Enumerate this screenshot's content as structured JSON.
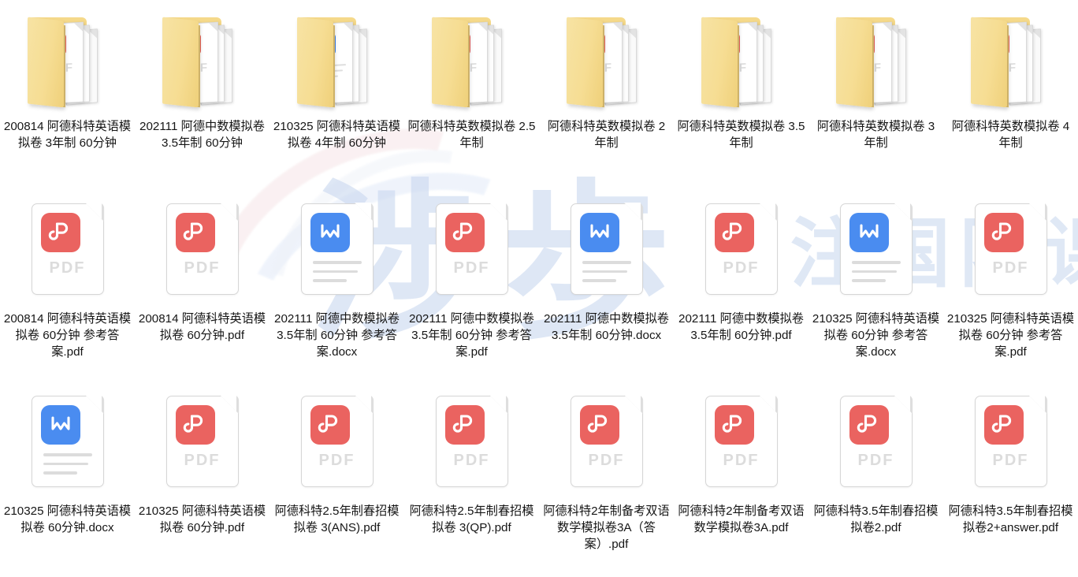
{
  "window": {
    "view_mode": "large-icons-grid",
    "columns": 8,
    "rows": 3,
    "item_count": 24
  },
  "watermark": {
    "mark_main": "渉歩",
    "mark_secondary": "专注国际课程在线",
    "color": "#cbd9f0"
  },
  "colors": {
    "folder": "#f6dd93",
    "folder_edge": "#e6c878",
    "pdf_badge": "#ea6360",
    "word_badge": "#4a8cf0",
    "file_border": "#d6d6d6",
    "type_text": "#dcdcdc",
    "label_text": "#161616",
    "background": "#ffffff"
  },
  "items": [
    {
      "kind": "folder",
      "inner_doc": "pdf",
      "icon_name": "folder-icon",
      "name": "200814 阿德科特英语模拟卷 3年制 60分钟"
    },
    {
      "kind": "folder",
      "inner_doc": "pdf",
      "icon_name": "folder-icon",
      "name": "202111 阿德中数模拟卷 3.5年制 60分钟"
    },
    {
      "kind": "folder",
      "inner_doc": "word",
      "icon_name": "folder-icon",
      "name": "210325 阿德科特英语模拟卷 4年制 60分钟"
    },
    {
      "kind": "folder",
      "inner_doc": "pdf",
      "icon_name": "folder-icon",
      "name": "阿德科特英数模拟卷 2.5年制"
    },
    {
      "kind": "folder",
      "inner_doc": "pdf",
      "icon_name": "folder-icon",
      "name": "阿德科特英数模拟卷 2年制"
    },
    {
      "kind": "folder",
      "inner_doc": "pdf",
      "icon_name": "folder-icon",
      "name": "阿德科特英数模拟卷 3.5年制"
    },
    {
      "kind": "folder",
      "inner_doc": "pdf",
      "icon_name": "folder-icon",
      "name": "阿德科特英数模拟卷 3年制"
    },
    {
      "kind": "folder",
      "inner_doc": "pdf",
      "icon_name": "folder-icon",
      "name": "阿德科特英数模拟卷 4年制"
    },
    {
      "kind": "file",
      "file_type": "pdf",
      "type_text": "PDF",
      "icon_name": "pdf-file-icon",
      "name": "200814 阿德科特英语模拟卷 60分钟 参考答案.pdf"
    },
    {
      "kind": "file",
      "file_type": "pdf",
      "type_text": "PDF",
      "icon_name": "pdf-file-icon",
      "name": "200814 阿德科特英语模拟卷 60分钟.pdf"
    },
    {
      "kind": "file",
      "file_type": "word",
      "type_text": "",
      "icon_name": "word-file-icon",
      "name": "202111 阿德中数模拟卷 3.5年制 60分钟 参考答案.docx"
    },
    {
      "kind": "file",
      "file_type": "pdf",
      "type_text": "PDF",
      "icon_name": "pdf-file-icon",
      "name": "202111 阿德中数模拟卷 3.5年制 60分钟 参考答案.pdf"
    },
    {
      "kind": "file",
      "file_type": "word",
      "type_text": "",
      "icon_name": "word-file-icon",
      "name": "202111 阿德中数模拟卷 3.5年制 60分钟.docx"
    },
    {
      "kind": "file",
      "file_type": "pdf",
      "type_text": "PDF",
      "icon_name": "pdf-file-icon",
      "name": "202111 阿德中数模拟卷 3.5年制 60分钟.pdf"
    },
    {
      "kind": "file",
      "file_type": "word",
      "type_text": "",
      "icon_name": "word-file-icon",
      "name": "210325 阿德科特英语模拟卷 60分钟 参考答案.docx"
    },
    {
      "kind": "file",
      "file_type": "pdf",
      "type_text": "PDF",
      "icon_name": "pdf-file-icon",
      "name": "210325 阿德科特英语模拟卷 60分钟 参考答案.pdf"
    },
    {
      "kind": "file",
      "file_type": "word",
      "type_text": "",
      "icon_name": "word-file-icon",
      "name": "210325 阿德科特英语模拟卷 60分钟.docx"
    },
    {
      "kind": "file",
      "file_type": "pdf",
      "type_text": "PDF",
      "icon_name": "pdf-file-icon",
      "name": "210325 阿德科特英语模拟卷 60分钟.pdf"
    },
    {
      "kind": "file",
      "file_type": "pdf",
      "type_text": "PDF",
      "icon_name": "pdf-file-icon",
      "name": "阿德科特2.5年制春招模拟卷 3(ANS).pdf"
    },
    {
      "kind": "file",
      "file_type": "pdf",
      "type_text": "PDF",
      "icon_name": "pdf-file-icon",
      "name": "阿德科特2.5年制春招模拟卷 3(QP).pdf"
    },
    {
      "kind": "file",
      "file_type": "pdf",
      "type_text": "PDF",
      "icon_name": "pdf-file-icon",
      "name": "阿德科特2年制备考双语数学模拟卷3A（答案）.pdf"
    },
    {
      "kind": "file",
      "file_type": "pdf",
      "type_text": "PDF",
      "icon_name": "pdf-file-icon",
      "name": "阿德科特2年制备考双语数学模拟卷3A.pdf"
    },
    {
      "kind": "file",
      "file_type": "pdf",
      "type_text": "PDF",
      "icon_name": "pdf-file-icon",
      "name": "阿德科特3.5年制春招模拟卷2.pdf"
    },
    {
      "kind": "file",
      "file_type": "pdf",
      "type_text": "PDF",
      "icon_name": "pdf-file-icon",
      "name": "阿德科特3.5年制春招模拟卷2+answer.pdf"
    }
  ]
}
